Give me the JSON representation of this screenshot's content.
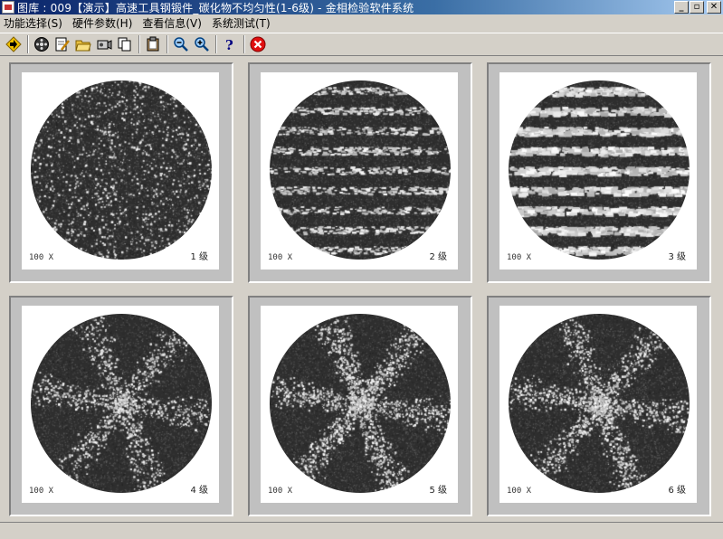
{
  "window": {
    "title": "图库 : 009【演示】高速工具钢锻件_碳化物不均匀性(1-6级) - 金相检验软件系统",
    "min_label": "_",
    "max_label": "▫",
    "close_label": "✕"
  },
  "menu": [
    "功能选择(S)",
    "硬件参数(H)",
    "查看信息(V)",
    "系统测试(T)"
  ],
  "toolbar": [
    "arrow-right-icon",
    "film-reel-icon",
    "edit-doc-icon",
    "open-folder-icon",
    "camera-icon",
    "copy-icon",
    "clipboard-icon",
    "zoom-out-icon",
    "zoom-in-icon",
    "help-icon",
    "close-red-icon"
  ],
  "tiles": [
    {
      "mag": "100 X",
      "grade": "1 级",
      "density": 0.12
    },
    {
      "mag": "100 X",
      "grade": "2 级",
      "density": 0.22
    },
    {
      "mag": "100 X",
      "grade": "3 级",
      "density": 0.32
    },
    {
      "mag": "100 X",
      "grade": "4 级",
      "density": 0.16
    },
    {
      "mag": "100 X",
      "grade": "5 级",
      "density": 0.3
    },
    {
      "mag": "100 X",
      "grade": "6 级",
      "density": 0.24
    }
  ]
}
